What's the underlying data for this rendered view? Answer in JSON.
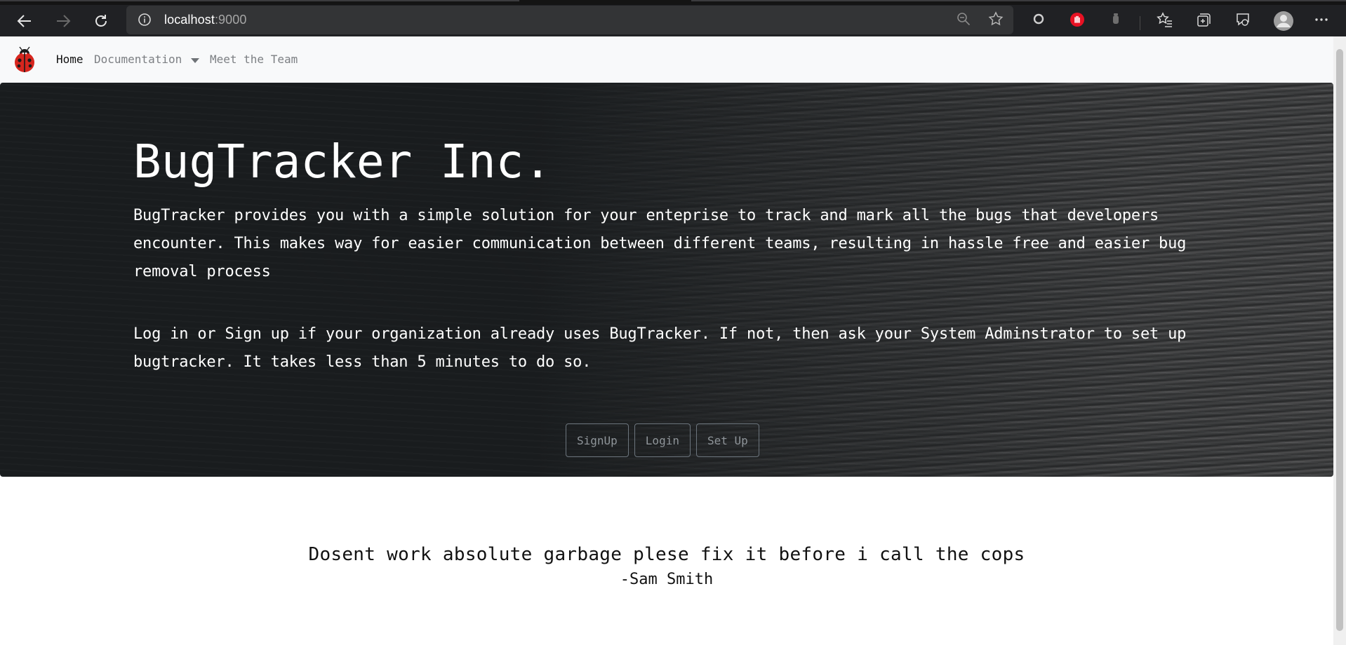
{
  "browser": {
    "url_host": "localhost",
    "url_port": ":9000"
  },
  "site_nav": {
    "items": [
      {
        "label": "Home"
      },
      {
        "label": "Documentation"
      },
      {
        "label": "Meet the Team"
      }
    ]
  },
  "hero": {
    "title": "BugTracker Inc.",
    "paragraph1": "BugTracker provides you with a simple solution for your enteprise to track and mark all the bugs that developers encounter. This makes way for easier communication between different teams, resulting in hassle free and easier bug removal process",
    "paragraph2": "Log in or Sign up if your organization already uses BugTracker. If not, then ask your System Adminstrator to set up bugtracker. It takes less than 5 minutes to do so.",
    "buttons": [
      {
        "label": "SignUp"
      },
      {
        "label": "Login"
      },
      {
        "label": "Set Up"
      }
    ]
  },
  "testimonial": {
    "quote": "Dosent work absolute garbage plese fix it before i call the cops",
    "author": "-Sam Smith"
  },
  "colors": {
    "browser_chrome": "#202124",
    "address_bar": "#333436",
    "navbar_bg": "#f8f9fa",
    "hero_dark": "#1b1e20",
    "button_outline": "#6c757d"
  }
}
